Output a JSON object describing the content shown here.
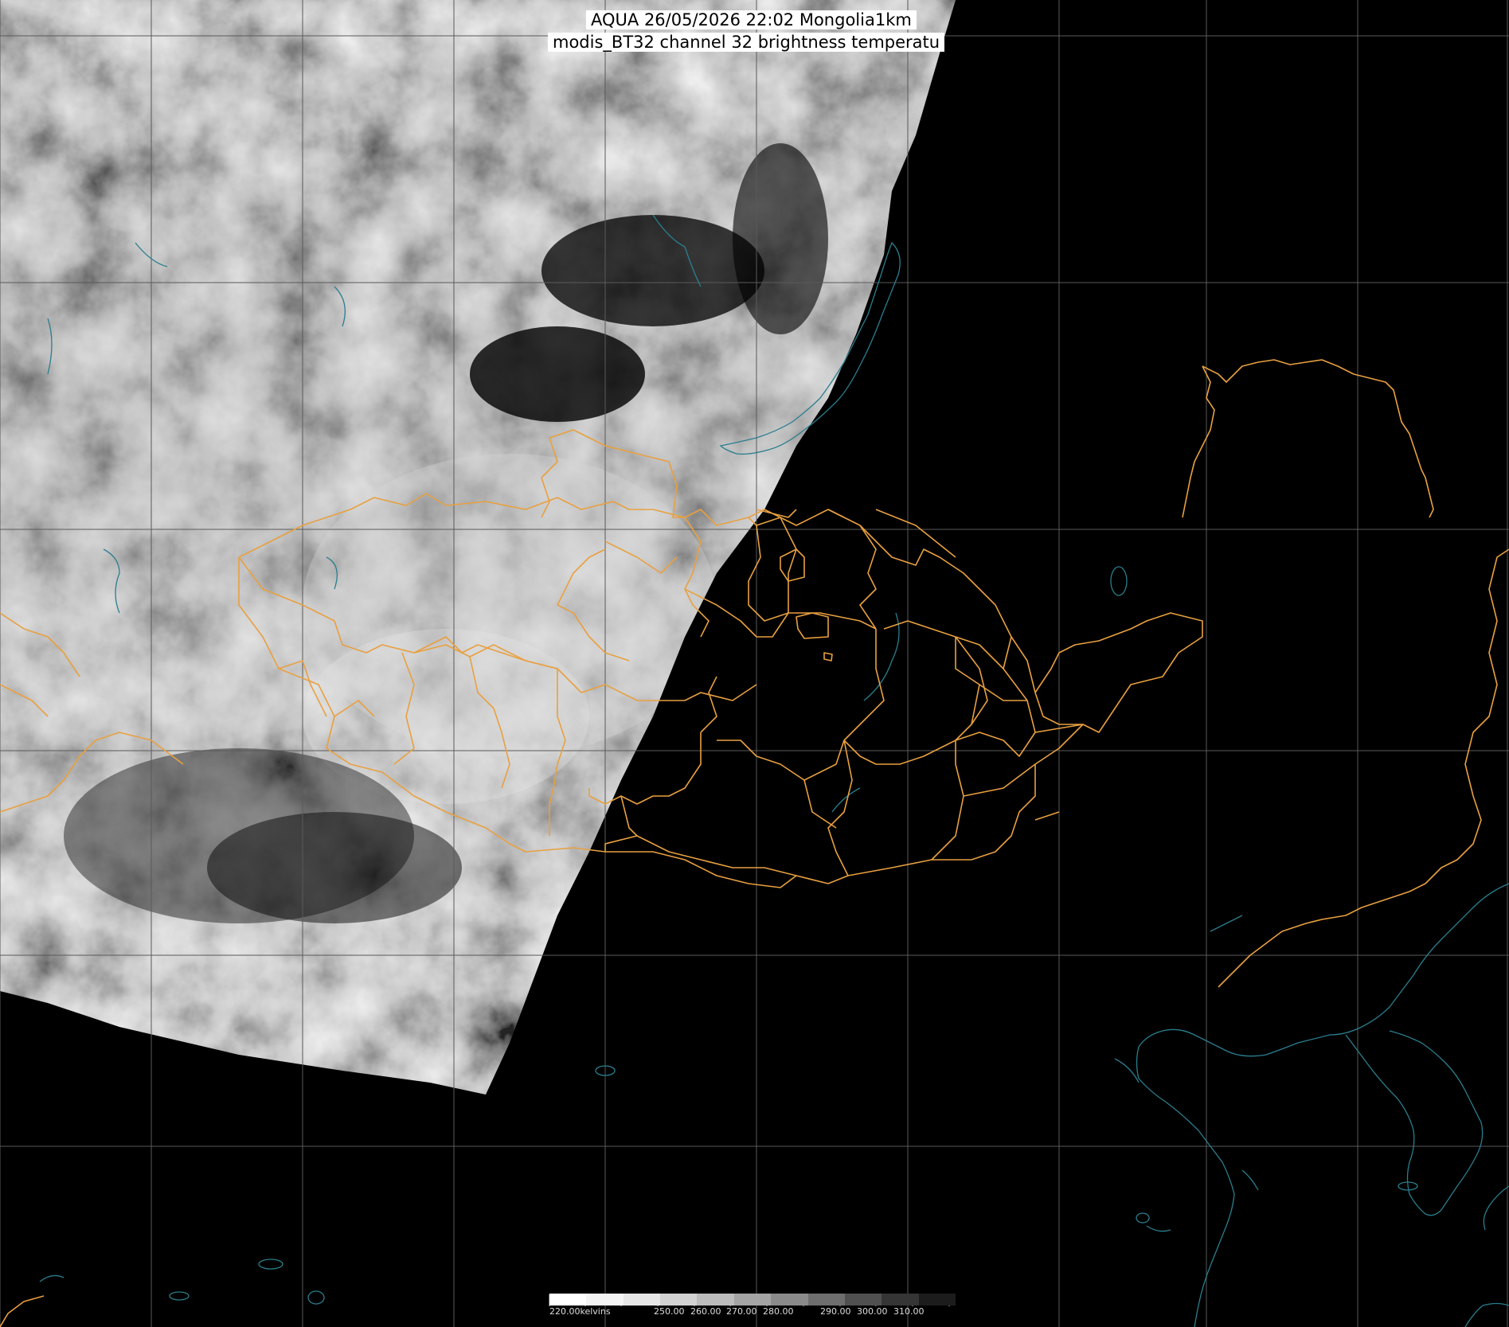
{
  "title": {
    "line1": "AQUA 26/05/2026 22:02 Mongolia1km",
    "line2": "modis_BT32 channel 32 brightness temperatu"
  },
  "colors": {
    "background": "#000000",
    "grid": "#5a5a5a",
    "admin_border": "#e8a040",
    "coastline": "#2a7e8e",
    "title_bg": "#ffffff"
  },
  "colorbar": {
    "labels": [
      "220.00kelvins",
      "250.00",
      "260.00",
      "270.00",
      "280.00",
      "290.00",
      "300.00",
      "310.00"
    ]
  }
}
